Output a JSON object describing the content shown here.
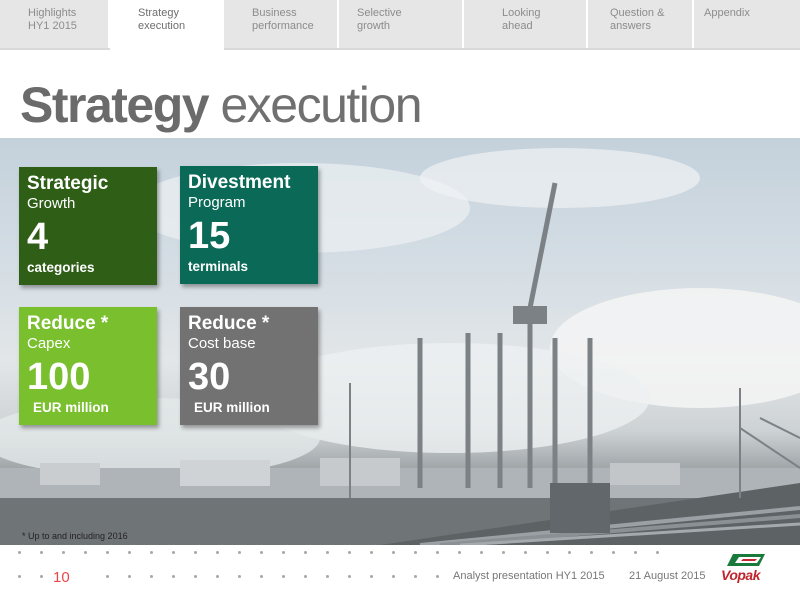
{
  "nav": {
    "tabs": [
      {
        "line1": "Highlights",
        "line2": "HY1 2015"
      },
      {
        "line1": "Strategy",
        "line2": "execution"
      },
      {
        "line1": "Business",
        "line2": "performance"
      },
      {
        "line1": "Selective",
        "line2": "growth"
      },
      {
        "line1": "Looking",
        "line2": "ahead"
      },
      {
        "line1": "Question &",
        "line2": "answers"
      },
      {
        "line1": "Appendix",
        "line2": ""
      }
    ],
    "active_tab": "Strategy execution"
  },
  "title": {
    "bold": "Strategy",
    "regular": "execution"
  },
  "tiles": [
    {
      "heading": "Strategic",
      "sub": "Growth",
      "value": "4",
      "unit": "categories",
      "color": "#2f5e17"
    },
    {
      "heading": "Divestment",
      "sub": "Program",
      "value": "15",
      "unit": "terminals",
      "color": "#0b6a57"
    },
    {
      "heading": "Reduce *",
      "sub": "Capex",
      "value": "100",
      "unit": "EUR million",
      "color": "#79bf2e"
    },
    {
      "heading": "Reduce *",
      "sub": "Cost base",
      "value": "30",
      "unit": "EUR million",
      "color": "#727272"
    }
  ],
  "footnote": "*  Up to and including 2016",
  "footer": {
    "page_number": "10",
    "presentation": "Analyst presentation HY1 2015",
    "date": "21 August 2015",
    "logo_text": "Vopak"
  },
  "colors": {
    "accent_red": "#e8474c",
    "logo_red": "#c0262d",
    "logo_green": "#1a7a3c"
  }
}
